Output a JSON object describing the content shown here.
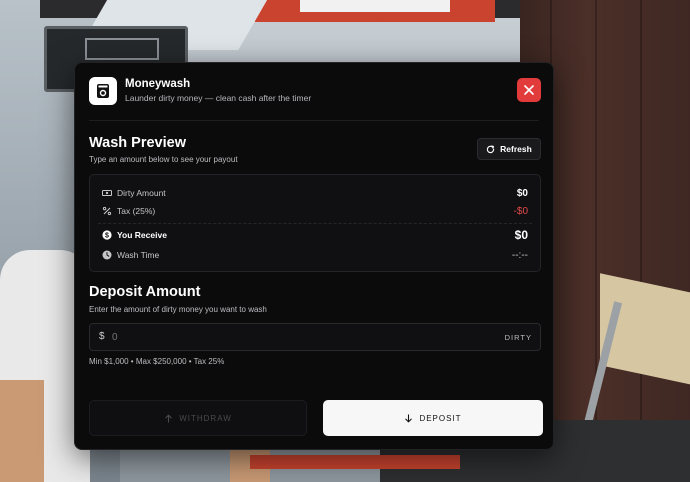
{
  "app": {
    "title": "Moneywash",
    "subtitle": "Launder dirty money — clean cash after the timer"
  },
  "preview": {
    "title": "Wash Preview",
    "subtitle": "Type an amount below to see your payout",
    "refresh_label": "Refresh",
    "rows": [
      {
        "label": "Dirty Amount",
        "value": "$0",
        "icon": "cash-icon"
      },
      {
        "label": "Tax (25%)",
        "value": "-$0",
        "icon": "percent-icon"
      },
      {
        "label": "You Receive",
        "value": "$0",
        "icon": "dollar-circle-icon"
      },
      {
        "label": "Wash Time",
        "value": "--:--",
        "icon": "clock-icon"
      }
    ]
  },
  "deposit": {
    "title": "Deposit Amount",
    "subtitle": "Enter the amount of dirty money you want to wash",
    "currency_symbol": "$",
    "input_value": "",
    "input_placeholder": "0",
    "input_tag": "DIRTY",
    "limits": "Min $1,000 • Max $250,000 • Tax 25%"
  },
  "actions": {
    "withdraw_label": "WITHDRAW",
    "deposit_label": "DEPOSIT"
  },
  "colors": {
    "panel": "#0b0b0c",
    "accent_close": "#e23b3b",
    "negative": "#e24b4b",
    "primary_button": "#f7f7f7"
  }
}
